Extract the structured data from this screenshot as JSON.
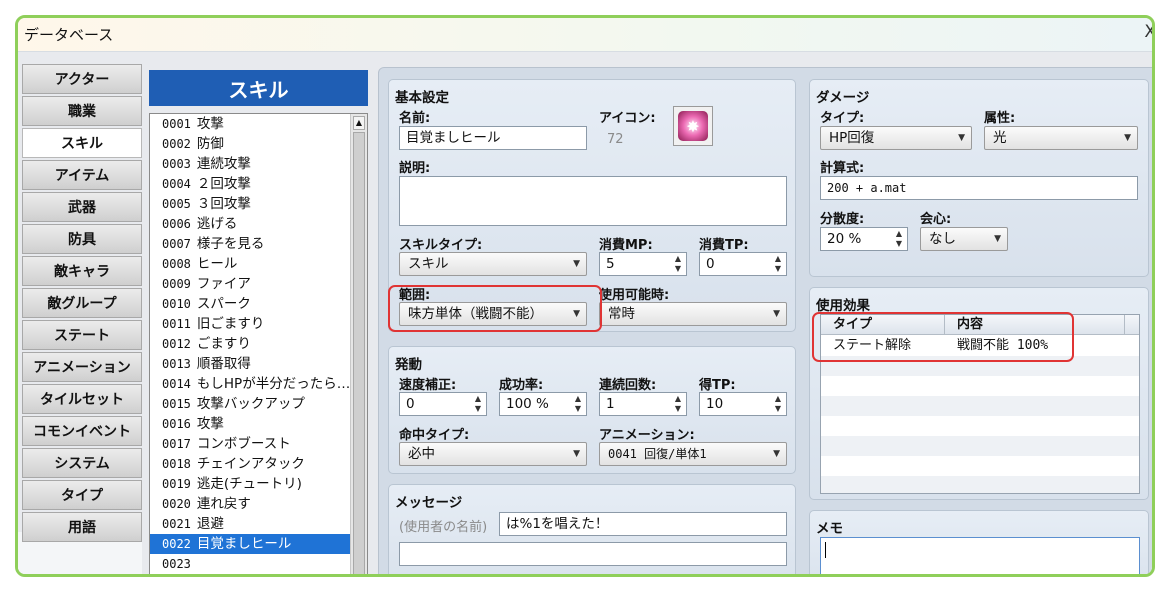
{
  "window": {
    "title": "データベース",
    "close_glyph": "X"
  },
  "categories": [
    {
      "label": "アクター",
      "active": false
    },
    {
      "label": "職業",
      "active": false
    },
    {
      "label": "スキル",
      "active": true
    },
    {
      "label": "アイテム",
      "active": false
    },
    {
      "label": "武器",
      "active": false
    },
    {
      "label": "防具",
      "active": false
    },
    {
      "label": "敵キャラ",
      "active": false
    },
    {
      "label": "敵グループ",
      "active": false
    },
    {
      "label": "ステート",
      "active": false
    },
    {
      "label": "アニメーション",
      "active": false
    },
    {
      "label": "タイルセット",
      "active": false
    },
    {
      "label": "コモンイベント",
      "active": false
    },
    {
      "label": "システム",
      "active": false
    },
    {
      "label": "タイプ",
      "active": false
    },
    {
      "label": "用語",
      "active": false
    }
  ],
  "skill_list": {
    "header": "スキル",
    "items": [
      {
        "num": "0001",
        "name": "攻撃"
      },
      {
        "num": "0002",
        "name": "防御"
      },
      {
        "num": "0003",
        "name": "連続攻撃"
      },
      {
        "num": "0004",
        "name": "２回攻撃"
      },
      {
        "num": "0005",
        "name": "３回攻撃"
      },
      {
        "num": "0006",
        "name": "逃げる"
      },
      {
        "num": "0007",
        "name": "様子を見る"
      },
      {
        "num": "0008",
        "name": "ヒール"
      },
      {
        "num": "0009",
        "name": "ファイア"
      },
      {
        "num": "0010",
        "name": "スパーク"
      },
      {
        "num": "0011",
        "name": "旧ごますり"
      },
      {
        "num": "0012",
        "name": "ごますり"
      },
      {
        "num": "0013",
        "name": "順番取得"
      },
      {
        "num": "0014",
        "name": "もしHPが半分だったら…"
      },
      {
        "num": "0015",
        "name": "攻撃バックアップ"
      },
      {
        "num": "0016",
        "name": "攻撃"
      },
      {
        "num": "0017",
        "name": "コンボブースト"
      },
      {
        "num": "0018",
        "name": "チェインアタック"
      },
      {
        "num": "0019",
        "name": "逃走(チュートリ)"
      },
      {
        "num": "0020",
        "name": "連れ戻す"
      },
      {
        "num": "0021",
        "name": "退避"
      },
      {
        "num": "0022",
        "name": "目覚ましヒール"
      },
      {
        "num": "0023",
        "name": ""
      }
    ],
    "selected_index": 21
  },
  "basic": {
    "title": "基本設定",
    "name_label": "名前:",
    "name_value": "目覚ましヒール",
    "icon_label": "アイコン:",
    "icon_index": "72",
    "icon": "sparkle-icon",
    "desc_label": "説明:",
    "desc_value": "",
    "skill_type_label": "スキルタイプ:",
    "skill_type_value": "スキル",
    "mp_label": "消費MP:",
    "mp_value": "5",
    "tp_label": "消費TP:",
    "tp_value": "0",
    "scope_label": "範囲:",
    "scope_value": "味方単体（戦闘不能）",
    "occasion_label": "使用可能時:",
    "occasion_value": "常時"
  },
  "invocation": {
    "title": "発動",
    "speed_label": "速度補正:",
    "speed_value": "0",
    "success_label": "成功率:",
    "success_value": "100 %",
    "repeat_label": "連続回数:",
    "repeat_value": "1",
    "tpgain_label": "得TP:",
    "tpgain_value": "10",
    "hittype_label": "命中タイプ:",
    "hittype_value": "必中",
    "animation_label": "アニメーション:",
    "animation_value": "0041 回復/単体1"
  },
  "message": {
    "title": "メッセージ",
    "user_name_hint": "(使用者の名前)",
    "line1": "は%1を唱えた！",
    "line2": ""
  },
  "damage": {
    "title": "ダメージ",
    "type_label": "タイプ:",
    "type_value": "HP回復",
    "element_label": "属性:",
    "element_value": "光",
    "formula_label": "計算式:",
    "formula_value": "200 + a.mat",
    "variance_label": "分散度:",
    "variance_value": "20 %",
    "critical_label": "会心:",
    "critical_value": "なし"
  },
  "effects": {
    "title": "使用効果",
    "columns": [
      "タイプ",
      "内容"
    ],
    "rows": [
      {
        "type": "ステート解除",
        "content": "戦闘不能 100%"
      }
    ]
  },
  "memo": {
    "title": "メモ",
    "value": ""
  },
  "colors": {
    "highlight": "#e03434",
    "selection": "#1f73d6",
    "list_header": "#1f5eb4",
    "window_border": "#8fcf5a"
  }
}
